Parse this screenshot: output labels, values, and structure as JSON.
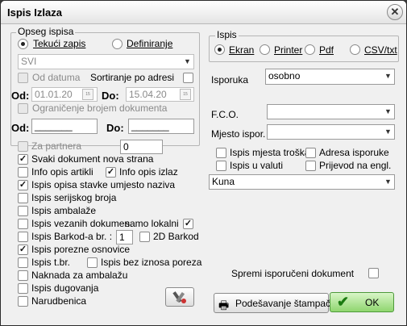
{
  "window": {
    "title": "Ispis Izlaza"
  },
  "opseg": {
    "label": "Opseg ispisa",
    "radio_tekuci": "Tekući zapis",
    "radio_definiranje": "Definiranje",
    "selection_value": "SVI",
    "od_datuma": "Od datuma",
    "sortiranje": "Sortiranje po adresi",
    "od_label": "Od:",
    "od_date": "01.01.20",
    "do_label": "Do:",
    "do_date": "15.04.20",
    "cal_icon_text": "15",
    "ogranicenje": "Ograničenje brojem dokumenta",
    "od2_label": "Od:",
    "od2_value": "_______",
    "do2_label": "Do:",
    "do2_value": "_______",
    "za_partnera": "Za partnera",
    "za_partnera_value": "0"
  },
  "options": [
    {
      "label": "Svaki dokument nova strana",
      "checked": true
    },
    {
      "label": "Info opis artikli",
      "checked": false
    },
    {
      "label": "Info opis izlaz",
      "checked": true
    },
    {
      "label": "Ispis opisa stavke umjesto naziva",
      "checked": true
    },
    {
      "label": "Ispis serijskog broja",
      "checked": false
    },
    {
      "label": "Ispis ambalaže",
      "checked": false
    },
    {
      "label": "Ispis vezanih dokumen.",
      "checked": false
    },
    {
      "label": "samo lokalni",
      "checked": true
    },
    {
      "label": "Ispis Barkod-a br. :",
      "checked": false
    },
    {
      "label": "2D Barkod",
      "checked": false
    },
    {
      "label": "Ispis porezne osnovice",
      "checked": true
    },
    {
      "label": "Ispis t.br.",
      "checked": false
    },
    {
      "label": "Ispis bez iznosa poreza",
      "checked": false
    },
    {
      "label": "Naknada za ambalažu",
      "checked": false
    },
    {
      "label": "Ispis dugovanja",
      "checked": false
    },
    {
      "label": "Narudbenica",
      "checked": false
    }
  ],
  "barkod_value": "1",
  "ispis": {
    "label": "Ispis",
    "ekran": "Ekran",
    "printer": "Printer",
    "pdf": "Pdf",
    "csv": "CSV/txt"
  },
  "isporuka": {
    "label": "Isporuka",
    "value": "osobno"
  },
  "fco": {
    "label": "F.C.O.",
    "value": ""
  },
  "mjesto": {
    "label": "Mjesto ispor.",
    "value": ""
  },
  "right_checks": [
    {
      "label": "Ispis mjesta troška",
      "checked": false
    },
    {
      "label": "Adresa isporuke",
      "checked": false
    },
    {
      "label": "Ispis u valuti",
      "checked": false
    },
    {
      "label": "Prijevod na engl.",
      "checked": false
    }
  ],
  "currency": {
    "value": "Kuna"
  },
  "spremi": {
    "label": "Spremi isporučeni dokument",
    "checked": false
  },
  "buttons": {
    "podesavanje": "Podešavanje štampača",
    "ok": "OK"
  },
  "colors": {
    "ok_green": "#8fd66e",
    "window_bg": "#f0f0f0"
  }
}
